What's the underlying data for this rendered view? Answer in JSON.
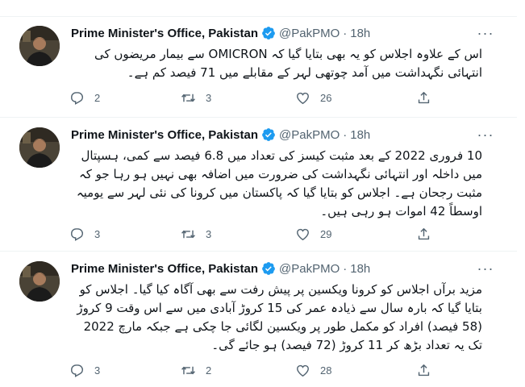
{
  "tweets": [
    {
      "name": "Prime Minister's Office, Pakistan",
      "handle": "@PakPMO",
      "dot": "·",
      "time": "18h",
      "text": "اس کے علاوہ اجلاس کو یہ بھی بتایا گیا کہ OMICRON سے بیمار مریضوں کی انتہائی نگہداشت میں آمد چوتھی لہر کے مقابلے میں 71 فیصد کم ہے۔",
      "replies": "2",
      "retweets": "3",
      "likes": "26"
    },
    {
      "name": "Prime Minister's Office, Pakistan",
      "handle": "@PakPMO",
      "dot": "·",
      "time": "18h",
      "text": "10 فروری 2022 کے بعد مثبت کیسز کی تعداد میں 6.8 فیصد سے کمی، ہسپتال میں داخلہ اور انتہائی نگہداشت کی ضرورت میں اضافہ بھی نہیں ہو رہا جو کہ مثبت رجحان ہے۔ اجلاس کو بتایا گیا کہ پاکستان میں کرونا کی نئی لہر سے یومیہ اوسطاً 42 اموات ہو رہی ہیں۔",
      "replies": "3",
      "retweets": "3",
      "likes": "29"
    },
    {
      "name": "Prime Minister's Office, Pakistan",
      "handle": "@PakPMO",
      "dot": "·",
      "time": "18h",
      "text": "مزید برآں اجلاس کو کرونا ویکسین پر پیش رفت سے بھی آگاہ کیا گیا۔ اجلاس کو بتایا گیا کہ بارہ سال سے ذیادہ عمر کی 15 کروڑ آبادی میں سے اس وقت 9 کروڑ (58 فیصد) افراد کو مکمل طور پر ویکسین لگائی جا چکی ہے جبکہ مارچ 2022 تک یہ تعداد بڑھ کر 11 کروڑ (72 فیصد) ہو جائے گی۔",
      "replies": "3",
      "retweets": "2",
      "likes": "28"
    }
  ],
  "colors": {
    "text": "#0f1419",
    "secondary": "#536471",
    "verified": "#1d9bf0",
    "border": "#eff3f4"
  },
  "icons": [
    "verified-badge-icon",
    "more-icon",
    "reply-icon",
    "retweet-icon",
    "like-icon",
    "share-icon"
  ]
}
